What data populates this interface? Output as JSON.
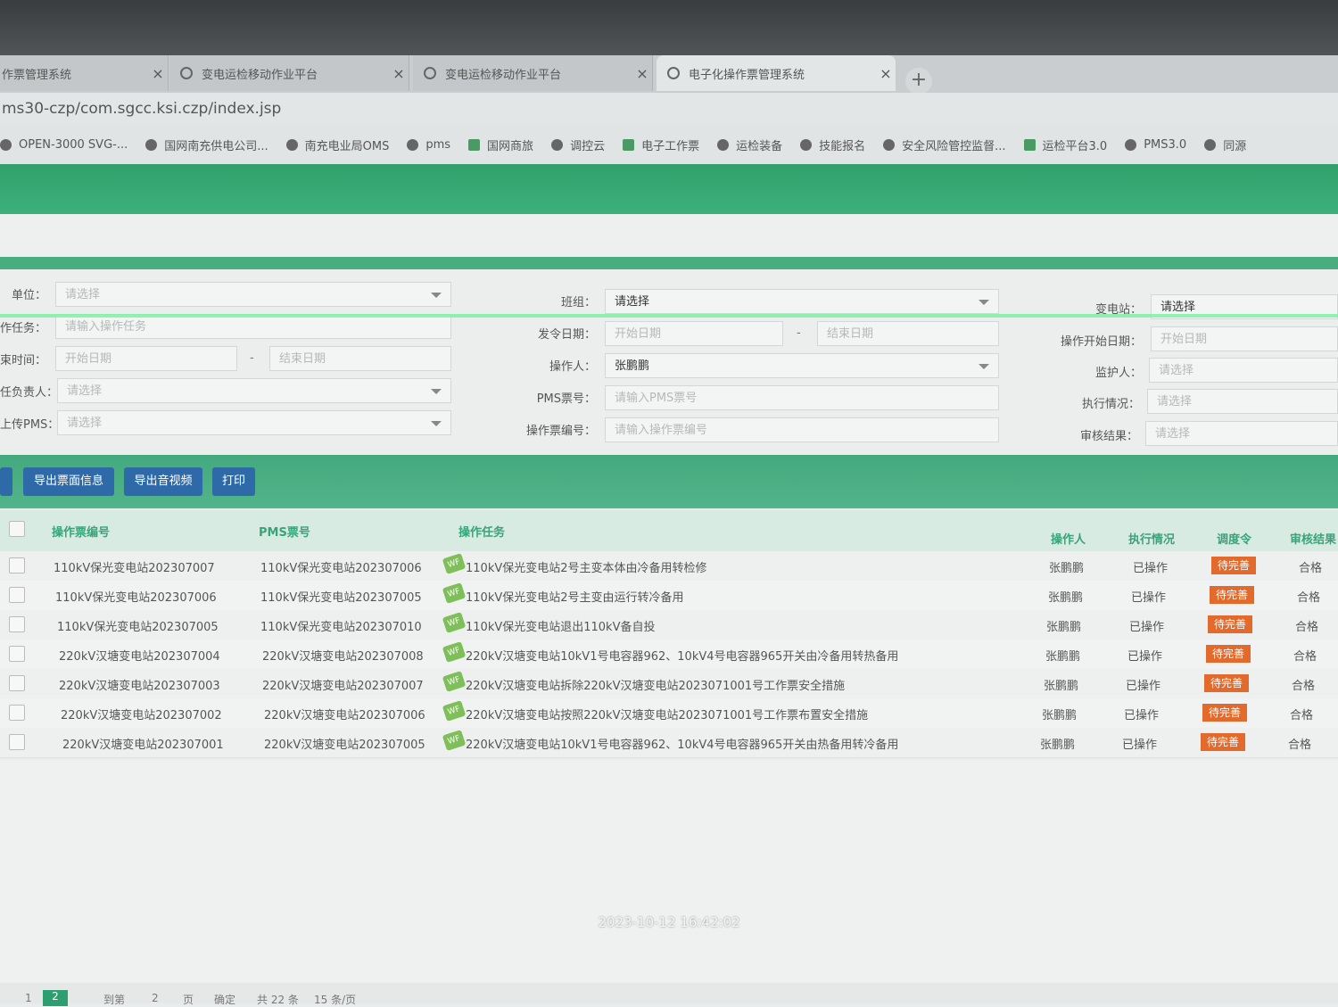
{
  "browser": {
    "tabs": [
      {
        "title": "作票管理系统",
        "active": false
      },
      {
        "title": "变电运检移动作业平台",
        "active": false
      },
      {
        "title": "变电运检移动作业平台",
        "active": false
      },
      {
        "title": "电子化操作票管理系统",
        "active": true
      }
    ],
    "new_tab": "+",
    "close": "×",
    "url": "ms30-czp/com.sgcc.ksi.czp/index.jsp",
    "bookmarks": [
      "OPEN-3000 SVG-...",
      "国网南充供电公司...",
      "南充电业局OMS",
      "pms",
      "国网商旅",
      "调控云",
      "电子工作票",
      "运检装备",
      "技能报名",
      "安全风险管控监督...",
      "运检平台3.0",
      "PMS3.0",
      "同源"
    ]
  },
  "filters": {
    "unit": {
      "label": "单位：",
      "placeholder": "请选择"
    },
    "task": {
      "label": "作任务：",
      "placeholder": "请输入操作任务"
    },
    "end_time": {
      "label": "束时间：",
      "start": "开始日期",
      "sep": "-",
      "end": "结束日期"
    },
    "leader": {
      "label": "任负责人：",
      "placeholder": "请选择"
    },
    "pms_upload": {
      "label": "上传PMS：",
      "placeholder": "请选择"
    },
    "team": {
      "label": "班组：",
      "placeholder": "请选择"
    },
    "issue_date": {
      "label": "发令日期：",
      "start": "开始日期",
      "sep": "-",
      "end": "结束日期"
    },
    "operator": {
      "label": "操作人：",
      "value": "张鹏鹏"
    },
    "pms_no": {
      "label": "PMS票号：",
      "placeholder": "请输入PMS票号"
    },
    "ticket_no": {
      "label": "操作票编号：",
      "placeholder": "请输入操作票编号"
    },
    "substation": {
      "label": "变电站：",
      "placeholder": "请选择"
    },
    "op_start": {
      "label": "操作开始日期：",
      "placeholder": "开始日期"
    },
    "guardian": {
      "label": "监护人：",
      "placeholder": "请选择"
    },
    "exec": {
      "label": "执行情况：",
      "placeholder": "请选择"
    },
    "review": {
      "label": "审核结果：",
      "placeholder": "请选择"
    }
  },
  "toolbar": {
    "export_info": "导出票面信息",
    "export_av": "导出音视频",
    "print": "打印"
  },
  "table": {
    "headers": [
      "操作票编号",
      "PMS票号",
      "操作任务",
      "操作人",
      "执行情况",
      "调度令",
      "审核结果"
    ],
    "rows": [
      {
        "no": "110kV保光变电站202307007",
        "pms": "110kV保光变电站202307006",
        "task": "110kV保光变电站2号主变本体由冷备用转检修",
        "op": "张鹏鹏",
        "exec": "已操作",
        "order": "待完善",
        "review": "合格"
      },
      {
        "no": "110kV保光变电站202307006",
        "pms": "110kV保光变电站202307005",
        "task": "110kV保光变电站2号主变由运行转冷备用",
        "op": "张鹏鹏",
        "exec": "已操作",
        "order": "待完善",
        "review": "合格"
      },
      {
        "no": "110kV保光变电站202307005",
        "pms": "110kV保光变电站202307010",
        "task": "110kV保光变电站退出110kV备自投",
        "op": "张鹏鹏",
        "exec": "已操作",
        "order": "待完善",
        "review": "合格"
      },
      {
        "no": "220kV汉塘变电站202307004",
        "pms": "220kV汉塘变电站202307008",
        "task": "220kV汉塘变电站10kV1号电容器962、10kV4号电容器965开关由冷备用转热备用",
        "op": "张鹏鹏",
        "exec": "已操作",
        "order": "待完善",
        "review": "合格"
      },
      {
        "no": "220kV汉塘变电站202307003",
        "pms": "220kV汉塘变电站202307007",
        "task": "220kV汉塘变电站拆除220kV汉塘变电站2023071001号工作票安全措施",
        "op": "张鹏鹏",
        "exec": "已操作",
        "order": "待完善",
        "review": "合格"
      },
      {
        "no": "220kV汉塘变电站202307002",
        "pms": "220kV汉塘变电站202307006",
        "task": "220kV汉塘变电站按照220kV汉塘变电站2023071001号工作票布置安全措施",
        "op": "张鹏鹏",
        "exec": "已操作",
        "order": "待完善",
        "review": "合格"
      },
      {
        "no": "220kV汉塘变电站202307001",
        "pms": "220kV汉塘变电站202307005",
        "task": "220kV汉塘变电站10kV1号电容器962、10kV4号电容器965开关由热备用转冷备用",
        "op": "张鹏鹏",
        "exec": "已操作",
        "order": "待完善",
        "review": "合格"
      }
    ]
  },
  "timestamp": "2023-10-12 16:42:02",
  "pager": {
    "first": "1",
    "current": "2",
    "goto": "到第",
    "page_input": "2",
    "page_unit": "页",
    "confirm": "确定",
    "total": "共 22 条",
    "per_page": "15 条/页"
  }
}
